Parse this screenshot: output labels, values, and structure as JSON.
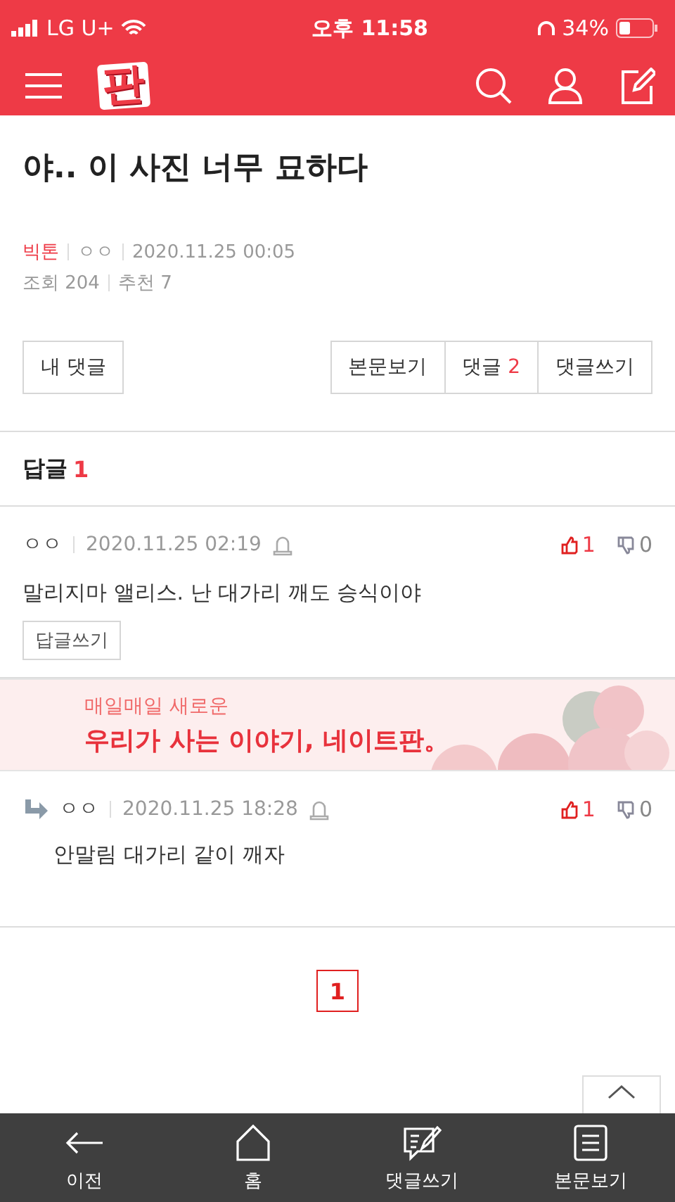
{
  "status_bar": {
    "carrier": "LG U+",
    "time": "오후 11:58",
    "battery": "34%"
  },
  "header": {
    "logo": "판"
  },
  "post": {
    "title": "야.. 이 사진 너무 묘하다",
    "board": "빅톤",
    "author": "ㅇㅇ",
    "date": "2020.11.25 00:05",
    "views": "조회 204",
    "recommends": "추천 7"
  },
  "actions": {
    "my_comments": "내 댓글",
    "view_post": "본문보기",
    "comments_label": "댓글",
    "comments_count": "2",
    "write": "댓글쓰기"
  },
  "replies_header": {
    "label": "답글",
    "count": "1"
  },
  "comments": [
    {
      "kind": "comment",
      "author": "ㅇㅇ",
      "date": "2020.11.25 02:19",
      "text": "말리지마 앨리스. 난 대가리 깨도 승식이야",
      "likes": "1",
      "dislikes": "0",
      "reply_button": "답글쓰기"
    },
    {
      "kind": "banner",
      "line1": "매일매일 새로운",
      "line2": "우리가 사는 이야기, 네이트판。"
    },
    {
      "kind": "reply",
      "author": "ㅇㅇ",
      "date": "2020.11.25 18:28",
      "text": "안말림 대가리 같이 깨자",
      "likes": "1",
      "dislikes": "0"
    }
  ],
  "pagination": [
    {
      "label": "1",
      "selected": true
    }
  ],
  "bottom_nav": [
    {
      "kind": "back",
      "label": "이전"
    },
    {
      "kind": "home",
      "label": "홈"
    },
    {
      "kind": "write",
      "label": "댓글쓰기"
    },
    {
      "kind": "document",
      "label": "본문보기"
    }
  ]
}
